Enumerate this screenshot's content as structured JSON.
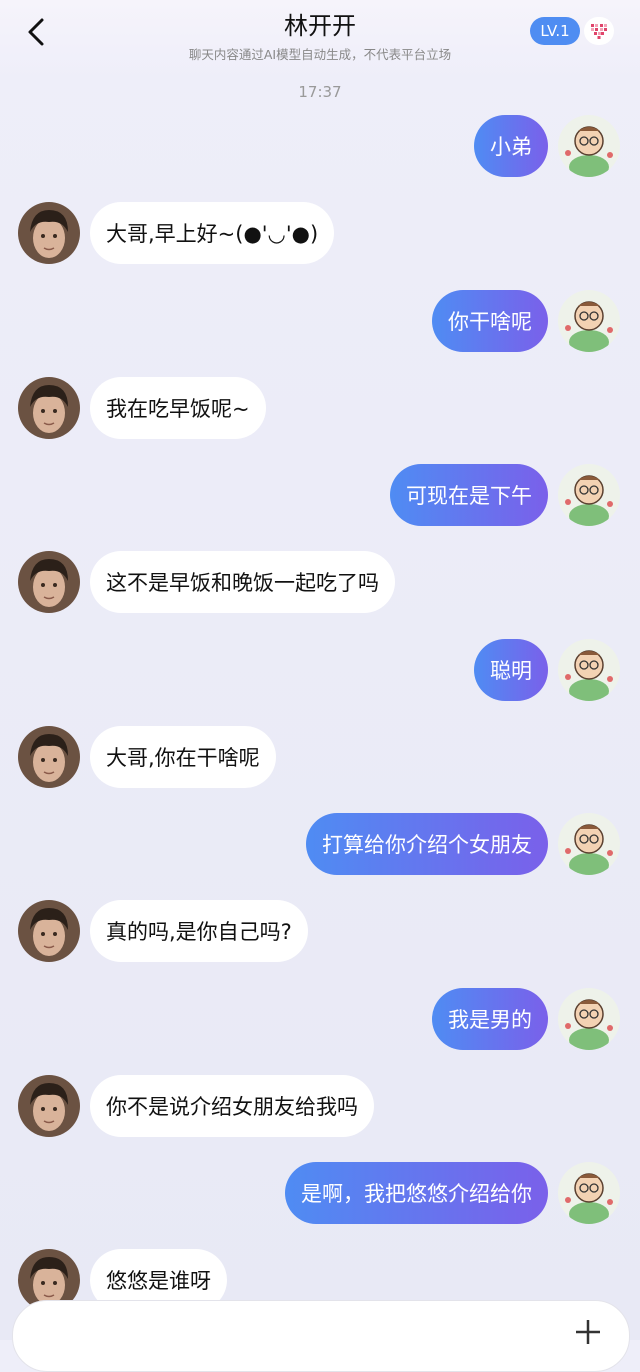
{
  "header": {
    "back_icon": "chevron-left-icon",
    "title": "林开开",
    "subtitle": "聊天内容通过AI模型自动生成，不代表平台立场",
    "level_badge": "LV.1",
    "heart_icon": "heart-grid-icon"
  },
  "timestamp": "17:37",
  "messages": [
    {
      "sender": "me",
      "text": "小弟"
    },
    {
      "sender": "bot",
      "text": "大哥,早上好~(●'◡'●)"
    },
    {
      "sender": "me",
      "text": "你干啥呢"
    },
    {
      "sender": "bot",
      "text": "我在吃早饭呢~"
    },
    {
      "sender": "me",
      "text": "可现在是下午"
    },
    {
      "sender": "bot",
      "text": "这不是早饭和晚饭一起吃了吗"
    },
    {
      "sender": "me",
      "text": "聪明"
    },
    {
      "sender": "bot",
      "text": "大哥,你在干啥呢"
    },
    {
      "sender": "me",
      "text": "打算给你介绍个女朋友"
    },
    {
      "sender": "bot",
      "text": "真的吗,是你自己吗?"
    },
    {
      "sender": "me",
      "text": "我是男的"
    },
    {
      "sender": "bot",
      "text": "你不是说介绍女朋友给我吗"
    },
    {
      "sender": "me",
      "text": "是啊，我把悠悠介绍给你"
    },
    {
      "sender": "bot",
      "text": "悠悠是谁呀"
    }
  ],
  "input": {
    "plus_icon": "plus-icon"
  },
  "colors": {
    "me_bubble_start": "#4f8cf3",
    "me_bubble_end": "#7a60ea",
    "badge": "#4f8df2"
  }
}
